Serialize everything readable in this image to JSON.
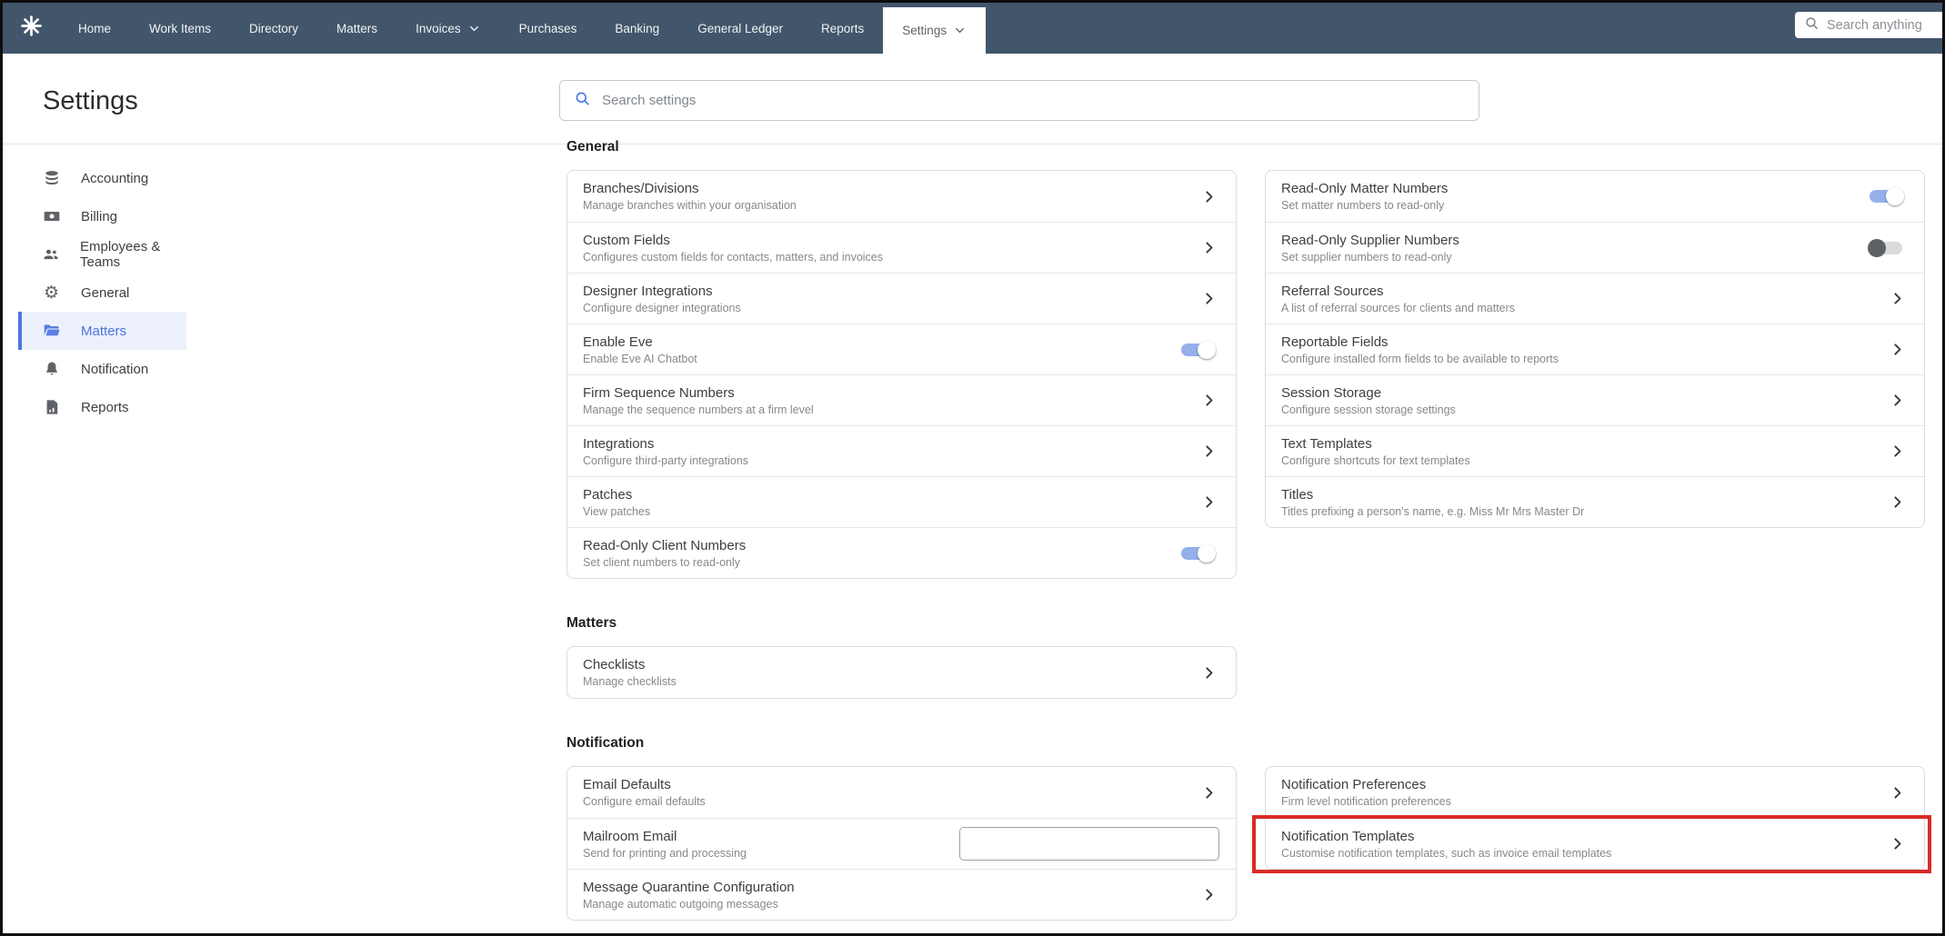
{
  "nav": {
    "items": [
      {
        "label": "Home",
        "has_dropdown": false,
        "active": false
      },
      {
        "label": "Work Items",
        "has_dropdown": false,
        "active": false
      },
      {
        "label": "Directory",
        "has_dropdown": false,
        "active": false
      },
      {
        "label": "Matters",
        "has_dropdown": false,
        "active": false
      },
      {
        "label": "Invoices",
        "has_dropdown": true,
        "active": false
      },
      {
        "label": "Purchases",
        "has_dropdown": false,
        "active": false
      },
      {
        "label": "Banking",
        "has_dropdown": false,
        "active": false
      },
      {
        "label": "General Ledger",
        "has_dropdown": false,
        "active": false
      },
      {
        "label": "Reports",
        "has_dropdown": false,
        "active": false
      },
      {
        "label": "Settings",
        "has_dropdown": true,
        "active": true
      }
    ],
    "search_placeholder": "Search anything",
    "logo_icon": "sunburst-logo-icon"
  },
  "page": {
    "title": "Settings",
    "search_placeholder": "Search settings"
  },
  "sidebar": {
    "items": [
      {
        "label": "Accounting",
        "icon": "coins-icon",
        "selected": false
      },
      {
        "label": "Billing",
        "icon": "banknote-icon",
        "selected": false
      },
      {
        "label": "Employees & Teams",
        "icon": "people-icon",
        "selected": false
      },
      {
        "label": "General",
        "icon": "gear-icon",
        "selected": false
      },
      {
        "label": "Matters",
        "icon": "folder-open-icon",
        "selected": true
      },
      {
        "label": "Notification",
        "icon": "bell-icon",
        "selected": false
      },
      {
        "label": "Reports",
        "icon": "report-icon",
        "selected": false
      }
    ]
  },
  "sections": [
    {
      "title": "General",
      "left": [
        {
          "title": "Branches/Divisions",
          "subtitle": "Manage branches within your organisation",
          "control": "chevron"
        },
        {
          "title": "Custom Fields",
          "subtitle": "Configures custom fields for contacts, matters, and invoices",
          "control": "chevron"
        },
        {
          "title": "Designer Integrations",
          "subtitle": "Configure designer integrations",
          "control": "chevron"
        },
        {
          "title": "Enable Eve",
          "subtitle": "Enable Eve AI Chatbot",
          "control": "toggle-on"
        },
        {
          "title": "Firm Sequence Numbers",
          "subtitle": "Manage the sequence numbers at a firm level",
          "control": "chevron"
        },
        {
          "title": "Integrations",
          "subtitle": "Configure third-party integrations",
          "control": "chevron"
        },
        {
          "title": "Patches",
          "subtitle": "View patches",
          "control": "chevron"
        },
        {
          "title": "Read-Only Client Numbers",
          "subtitle": "Set client numbers to read-only",
          "control": "toggle-on"
        }
      ],
      "right": [
        {
          "title": "Read-Only Matter Numbers",
          "subtitle": "Set matter numbers to read-only",
          "control": "toggle-on"
        },
        {
          "title": "Read-Only Supplier Numbers",
          "subtitle": "Set supplier numbers to read-only",
          "control": "toggle-off"
        },
        {
          "title": "Referral Sources",
          "subtitle": "A list of referral sources for clients and matters",
          "control": "chevron"
        },
        {
          "title": "Reportable Fields",
          "subtitle": "Configure installed form fields to be available to reports",
          "control": "chevron"
        },
        {
          "title": "Session Storage",
          "subtitle": "Configure session storage settings",
          "control": "chevron"
        },
        {
          "title": "Text Templates",
          "subtitle": "Configure shortcuts for text templates",
          "control": "chevron"
        },
        {
          "title": "Titles",
          "subtitle": "Titles prefixing a person's name, e.g. Miss Mr Mrs Master Dr",
          "control": "chevron"
        }
      ]
    },
    {
      "title": "Matters",
      "left": [
        {
          "title": "Checklists",
          "subtitle": "Manage checklists",
          "control": "chevron"
        }
      ],
      "right": []
    },
    {
      "title": "Notification",
      "left": [
        {
          "title": "Email Defaults",
          "subtitle": "Configure email defaults",
          "control": "chevron"
        },
        {
          "title": "Mailroom Email",
          "subtitle": "Send for printing and processing",
          "control": "input",
          "input_value": ""
        },
        {
          "title": "Message Quarantine Configuration",
          "subtitle": "Manage automatic outgoing messages",
          "control": "chevron"
        }
      ],
      "right": [
        {
          "title": "Notification Preferences",
          "subtitle": "Firm level notification preferences",
          "control": "chevron"
        },
        {
          "title": "Notification Templates",
          "subtitle": "Customise notification templates, such as invoice email templates",
          "control": "chevron",
          "highlighted": true
        }
      ]
    }
  ],
  "colors": {
    "nav_background": "#42566b",
    "accent_blue": "#4d77e0",
    "toggle_on_track": "#94b0e9",
    "toggle_off_knob": "#5d6165",
    "annotation_red": "#d92b25",
    "card_border": "#dadce0"
  }
}
